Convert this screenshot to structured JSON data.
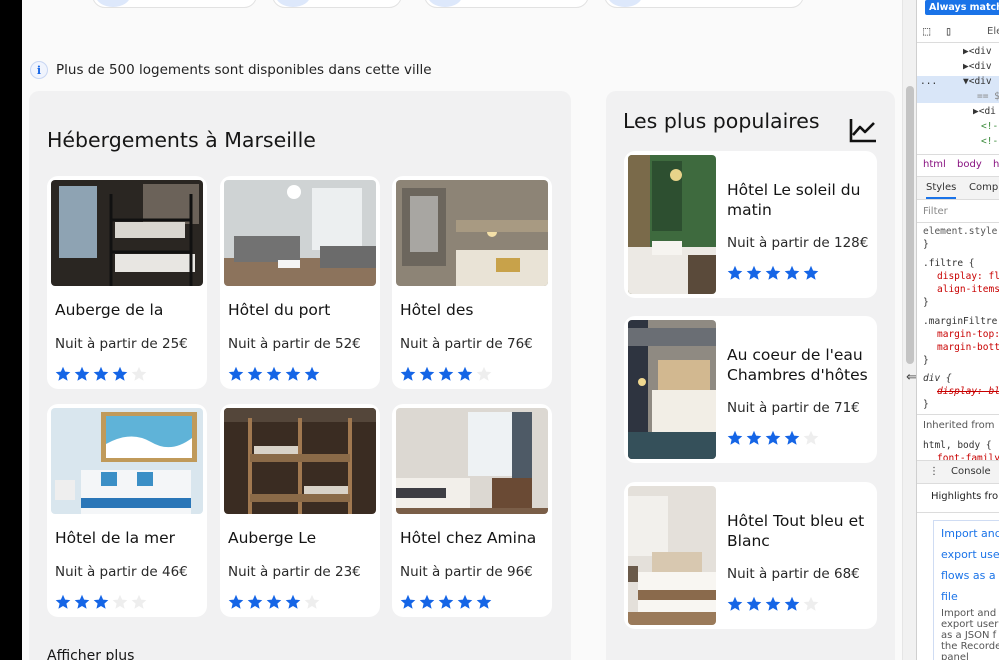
{
  "info_text": "Plus de 500 logements sont disponibles dans cette ville",
  "accommodations": {
    "title": "Hébergements à Marseille",
    "items": [
      {
        "name": "Auberge de la",
        "price": "Nuit à partir de 25€",
        "rating": 4
      },
      {
        "name": "Hôtel du port",
        "price": "Nuit à partir de 52€",
        "rating": 5
      },
      {
        "name": "Hôtel des",
        "price": "Nuit à partir de 76€",
        "rating": 4
      },
      {
        "name": "Hôtel de la mer",
        "price": "Nuit à partir de 46€",
        "rating": 3
      },
      {
        "name": "Auberge Le",
        "price": "Nuit à partir de 23€",
        "rating": 4
      },
      {
        "name": "Hôtel chez Amina",
        "price": "Nuit à partir de 96€",
        "rating": 5
      }
    ],
    "show_more": "Afficher plus"
  },
  "popular": {
    "title": "Les plus populaires",
    "items": [
      {
        "name": "Hôtel Le soleil du matin",
        "price": "Nuit à partir de 128€",
        "rating": 5
      },
      {
        "name": "Au coeur de l'eau Chambres d'hôtes",
        "price": "Nuit à partir de 71€",
        "rating": 4
      },
      {
        "name": "Hôtel Tout bleu et Blanc",
        "price": "Nuit à partir de 68€",
        "rating": 4
      }
    ]
  },
  "colors": {
    "star_filled": "#1565e6",
    "star_empty": "#eeeeee",
    "info_accent": "#1565e6"
  },
  "devtools": {
    "badge": "Always match C",
    "tab_elements": "Ele",
    "tree": [
      "▶<div",
      "▶<div",
      "▼<div",
      "== $",
      "▶<di",
      "<!-",
      "<!-"
    ],
    "breadcrumb": [
      "html",
      "body",
      "h"
    ],
    "style_tabs": [
      "Styles",
      "Comp"
    ],
    "filter_placeholder": "Filter",
    "css": [
      "element.style",
      "}",
      ".filtre {",
      "display: fl",
      "align-items",
      "}",
      ".marginFiltre",
      "margin-top:",
      "margin-bott",
      "}",
      "div {",
      "display: bl",
      "}",
      "Inherited from",
      "html, body {",
      "font-family"
    ],
    "console_tab": "Console",
    "highlights": "Highlights from",
    "links": [
      "Import and",
      "export use",
      "flows as a",
      "file"
    ],
    "note": [
      "Import and",
      "export user",
      "as a JSON f",
      "the Recorde",
      "panel"
    ],
    "ellipsis": "..."
  }
}
